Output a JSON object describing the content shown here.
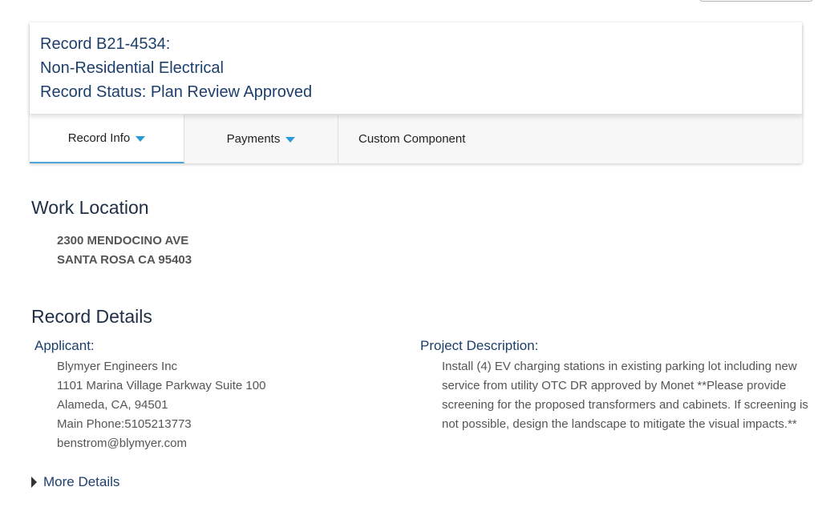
{
  "record": {
    "number_line": "Record B21-4534:",
    "type_line": "Non-Residential Electrical",
    "status_line": "Record Status: Plan Review Approved"
  },
  "tabs": [
    {
      "label": "Record Info",
      "has_dropdown": true,
      "active": true
    },
    {
      "label": "Payments",
      "has_dropdown": true,
      "active": false
    },
    {
      "label": "Custom Component",
      "has_dropdown": false,
      "active": false
    }
  ],
  "work_location": {
    "title": "Work Location",
    "address_line1": "2300 MENDOCINO AVE",
    "address_line2": "SANTA ROSA CA 95403"
  },
  "record_details": {
    "title": "Record Details",
    "applicant": {
      "label": "Applicant:",
      "company": "Blymyer Engineers Inc",
      "street": "1101 Marina Village Parkway Suite 100",
      "city_state_zip": "Alameda, CA, 94501",
      "phone": "Main Phone:5105213773",
      "email": "benstrom@blymyer.com"
    },
    "project_description": {
      "label": "Project Description:",
      "text": "Install (4) EV charging stations in existing parking lot including new service from utility OTC DR approved by Monet **Please provide screening for the proposed transformers and cabinets. If screening is not possible, design the landscape to mitigate the visual impacts.**"
    }
  },
  "more_details": {
    "label": "More Details"
  },
  "colors": {
    "accent_blue": "#2a9bd6",
    "heading_navy": "#1d3f6b",
    "tab_underline": "#4fa3d8"
  }
}
